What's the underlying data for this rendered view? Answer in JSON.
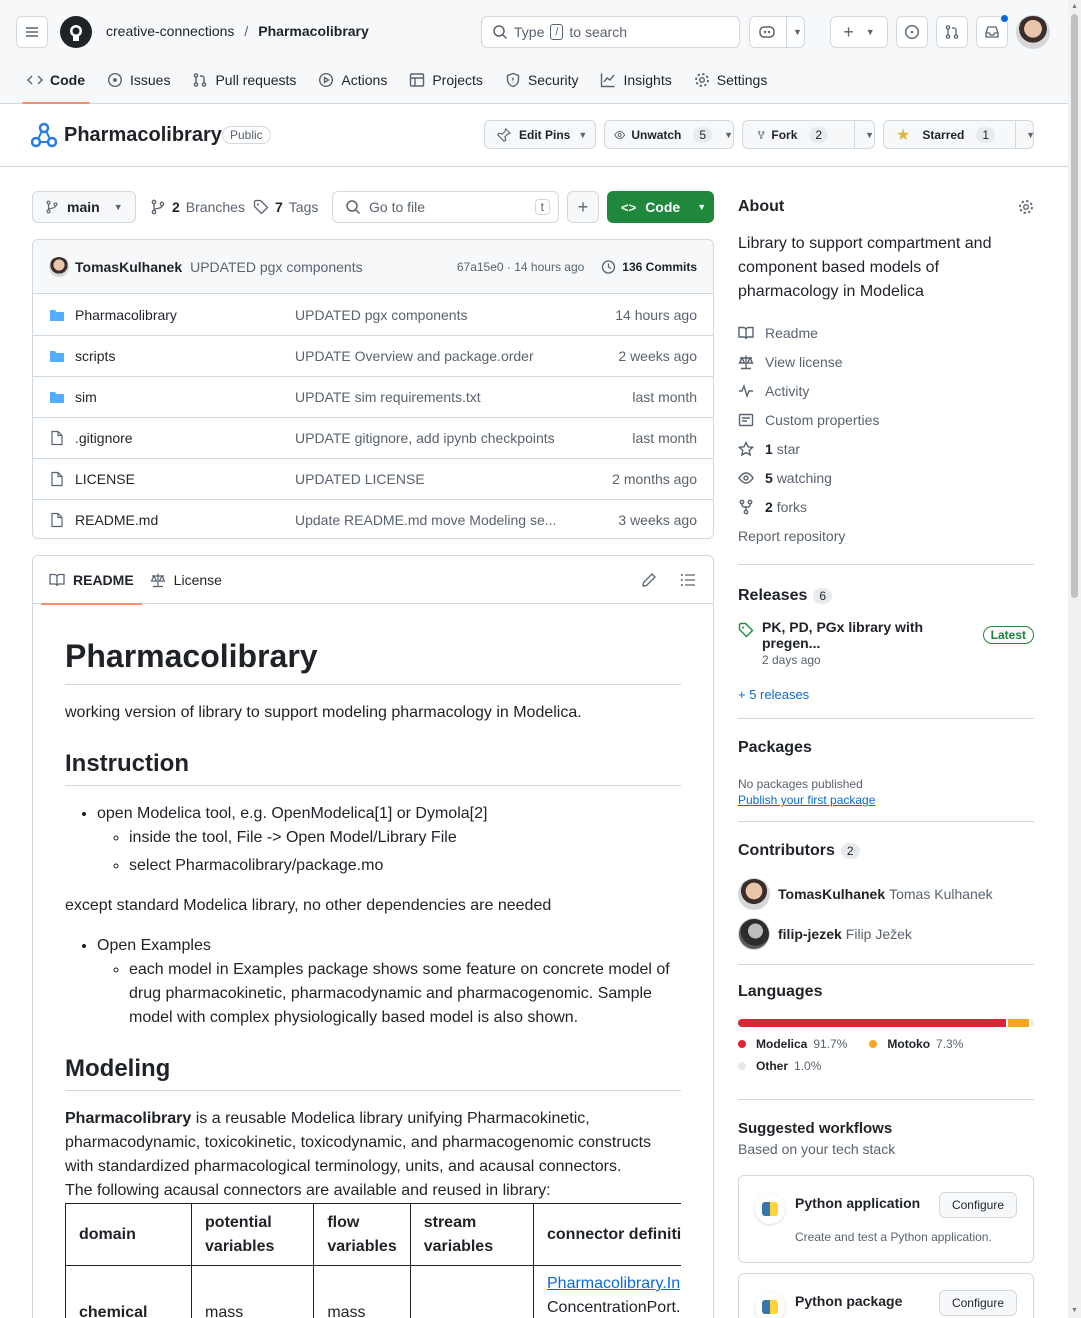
{
  "header": {
    "owner": "creative-connections",
    "separator": "/",
    "repo": "Pharmacolibrary",
    "search_prefix": "Type",
    "search_key": "/",
    "search_suffix": "to search"
  },
  "nav": {
    "tabs": [
      {
        "label": "Code",
        "icon": "code-icon"
      },
      {
        "label": "Issues",
        "icon": "issue-icon"
      },
      {
        "label": "Pull requests",
        "icon": "pull-request-icon"
      },
      {
        "label": "Actions",
        "icon": "play-icon"
      },
      {
        "label": "Projects",
        "icon": "table-icon"
      },
      {
        "label": "Security",
        "icon": "shield-icon"
      },
      {
        "label": "Insights",
        "icon": "graph-icon"
      },
      {
        "label": "Settings",
        "icon": "gear-icon"
      }
    ]
  },
  "repo": {
    "name": "Pharmacolibrary",
    "visibility": "Public",
    "edit_pins": "Edit Pins",
    "unwatch": "Unwatch",
    "watch_count": "5",
    "fork": "Fork",
    "fork_count": "2",
    "starred": "Starred",
    "star_count": "1"
  },
  "toolbar": {
    "branch": "main",
    "branches_count": "2",
    "branches_label": "Branches",
    "tags_count": "7",
    "tags_label": "Tags",
    "go_to_file": "Go to file",
    "go_to_file_key": "t",
    "code_button": "Code"
  },
  "commit": {
    "author": "TomasKulhanek",
    "message": "UPDATED pgx components",
    "hash_time": "67a15e0 · 14 hours ago",
    "commits": "136 Commits"
  },
  "files": [
    {
      "name": "Pharmacolibrary",
      "type": "folder",
      "message": "UPDATED pgx components",
      "date": "14 hours ago"
    },
    {
      "name": "scripts",
      "type": "folder",
      "message": "UPDATE Overview and package.order",
      "date": "2 weeks ago"
    },
    {
      "name": "sim",
      "type": "folder",
      "message": "UPDATE sim requirements.txt",
      "date": "last month"
    },
    {
      "name": ".gitignore",
      "type": "file",
      "message": "UPDATE gitignore, add ipynb checkpoints",
      "date": "last month"
    },
    {
      "name": "LICENSE",
      "type": "file",
      "message": "UPDATED LICENSE",
      "date": "2 months ago"
    },
    {
      "name": "README.md",
      "type": "file",
      "message": "Update README.md move Modeling se...",
      "date": "3 weeks ago"
    }
  ],
  "readme": {
    "tab_readme": "README",
    "tab_license": "License",
    "title": "Pharmacolibrary",
    "intro": "working version of library to support modeling pharmacology in Modelica.",
    "h_instruction": "Instruction",
    "li1": "open Modelica tool, e.g. OpenModelica[1] or Dymola[2]",
    "li1a": "inside the tool, File -> Open Model/Library File",
    "li1b": "select Pharmacolibrary/package.mo",
    "deps": "except standard Modelica library, no other dependencies are needed",
    "li2": "Open Examples",
    "li2a": "each model in Examples package shows some feature on concrete model of drug pharmacokinetic, pharmacodynamic and pharmacogenomic. Sample model with complex physiologically based model is also shown.",
    "h_modeling": "Modeling",
    "mod_bold": "Pharmacolibrary",
    "mod_text": " is a reusable Modelica library unifying Pharmacokinetic, pharmacodynamic, toxicokinetic, toxicodynamic, and pharmacogenomic constructs with standardized pharmacological terminology, units, and acausal connectors.",
    "mod_text2": "The following acausal connectors are available and reused in library:",
    "table_headers": [
      "domain",
      "potential variables",
      "flow variables",
      "stream variables",
      "connector definitio"
    ],
    "table_row": [
      "chemical",
      "mass",
      "mass",
      "",
      "Pharmacolibrary.In",
      "ConcentrationPort."
    ]
  },
  "about": {
    "title": "About",
    "description": "Library to support compartment and component based models of pharmacology in Modelica",
    "links": [
      {
        "label": "Readme",
        "icon": "book-icon"
      },
      {
        "label": "View license",
        "icon": "law-icon"
      },
      {
        "label": "Activity",
        "icon": "pulse-icon"
      },
      {
        "label": "Custom properties",
        "icon": "note-icon"
      }
    ],
    "star_count": "1",
    "star_label": "star",
    "watch_count": "5",
    "watch_label": "watching",
    "fork_count": "2",
    "fork_label": "forks",
    "report": "Report repository"
  },
  "releases": {
    "title": "Releases",
    "count": "6",
    "latest_name": "PK, PD, PGx library with pregen...",
    "latest_badge": "Latest",
    "latest_time": "2 days ago",
    "more": "+ 5 releases"
  },
  "packages": {
    "title": "Packages",
    "none": "No packages published",
    "publish": "Publish your first package"
  },
  "contributors": {
    "title": "Contributors",
    "count": "2",
    "list": [
      {
        "login": "TomasKulhanek",
        "name": "Tomas Kulhanek"
      },
      {
        "login": "filip-jezek",
        "name": "Filip Ježek"
      }
    ]
  },
  "languages": {
    "title": "Languages",
    "items": [
      {
        "name": "Modelica",
        "pct": "91.7%",
        "value": 91.7,
        "color": "#dc2438"
      },
      {
        "name": "Motoko",
        "pct": "7.3%",
        "value": 7.3,
        "color": "#f5a623"
      },
      {
        "name": "Other",
        "pct": "1.0%",
        "value": 1.0,
        "color": "#e8e8e8"
      }
    ]
  },
  "workflows": {
    "title": "Suggested workflows",
    "subtitle": "Based on your tech stack",
    "items": [
      {
        "name": "Python application",
        "desc": "Create and test a Python application.",
        "button": "Configure"
      },
      {
        "name": "Python package",
        "desc": "",
        "button": "Configure"
      }
    ]
  }
}
